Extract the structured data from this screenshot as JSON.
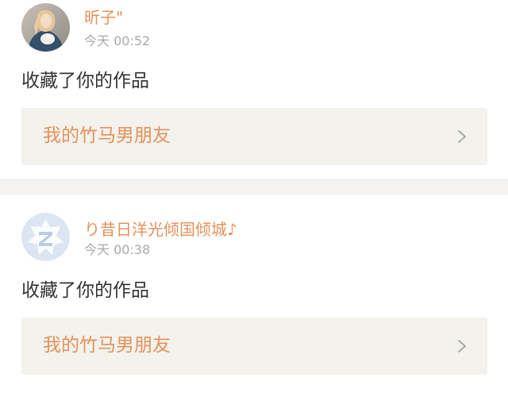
{
  "notifications": [
    {
      "username": "昕子\"",
      "time": "今天 00:52",
      "action": "收藏了你的作品",
      "work_title": "我的竹马男朋友",
      "avatar_icon": "user-photo-avatar",
      "chevron_icon": "chevron-right-icon"
    },
    {
      "username": "り昔日洋光倾国倾城♪",
      "time": "今天 00:38",
      "action": "收藏了你的作品",
      "work_title": "我的竹马男朋友",
      "avatar_icon": "default-z-logo-avatar",
      "chevron_icon": "chevron-right-icon"
    }
  ],
  "colors": {
    "accent": "#e3925a",
    "divider": "#f4f3f1",
    "link_background": "#f3f2ed",
    "secondary_text": "#a9a9a9",
    "default_avatar": "#dbe6f2"
  }
}
